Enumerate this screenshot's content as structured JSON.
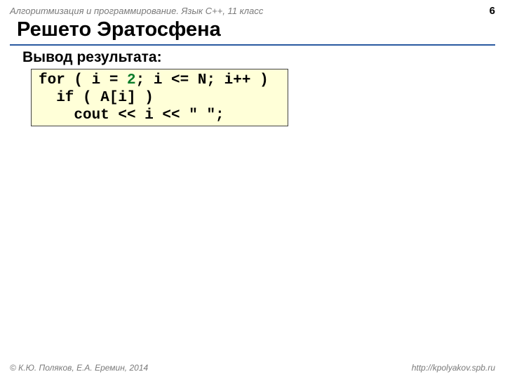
{
  "header": {
    "course": "Алгоритмизация и программирование. Язык C++, 11 класс",
    "page": "6"
  },
  "title": "Решето Эратосфена",
  "subtitle": "Вывод результата:",
  "code": {
    "l1a": "for ( i = ",
    "l1num": "2",
    "l1b": "; i <= N; i++ )",
    "l2": "  if ( A[i] )",
    "l3": "    cout << i << \" \";"
  },
  "footer": {
    "copyright": "© К.Ю. Поляков, Е.А. Еремин, 2014",
    "url": "http://kpolyakov.spb.ru"
  }
}
